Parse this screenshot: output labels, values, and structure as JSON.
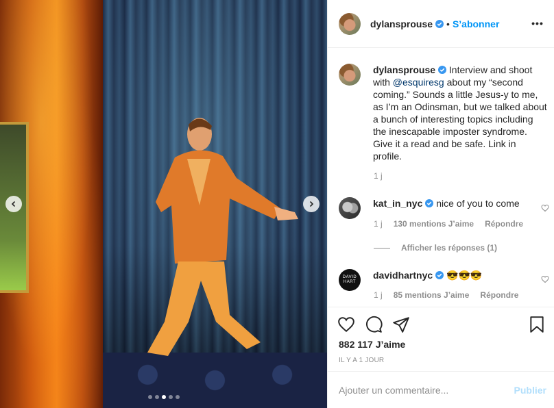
{
  "media": {
    "carousel_dots": [
      false,
      false,
      true,
      false,
      false
    ]
  },
  "header": {
    "username": "dylansprouse",
    "separator": "•",
    "follow_label": "S’abonner",
    "more_label": "•••"
  },
  "caption": {
    "username": "dylansprouse",
    "text_before": "Interview and shoot with",
    "mention": "@esquiresg",
    "text_after": "about my “second coming.” Sounds a little Jesus-y to me, as I’m an Odinsman, but we talked about a bunch of interesting topics including the inescapable imposter syndrome. Give it a read and be safe. Link in profile.",
    "time": "1 j"
  },
  "comments": [
    {
      "username": "kat_in_nyc",
      "text": "nice of you to come",
      "time": "1 j",
      "likes": "130 mentions J’aime",
      "reply_label": "Répondre",
      "view_replies": "Afficher les réponses (1)"
    },
    {
      "username": "davidhartnyc",
      "text": "😎😎😎",
      "time": "1 j",
      "likes": "85 mentions J’aime",
      "reply_label": "Répondre",
      "avatar_text": "DAVID HART"
    }
  ],
  "stats": {
    "likes": "882 117 J’aime",
    "posted": "IL Y A 1 JOUR"
  },
  "add_comment": {
    "placeholder": "Ajouter un commentaire...",
    "publish_label": "Publier"
  },
  "colors": {
    "accent": "#0095f6",
    "verified": "#3897f0",
    "muted": "#8e8e8e"
  }
}
